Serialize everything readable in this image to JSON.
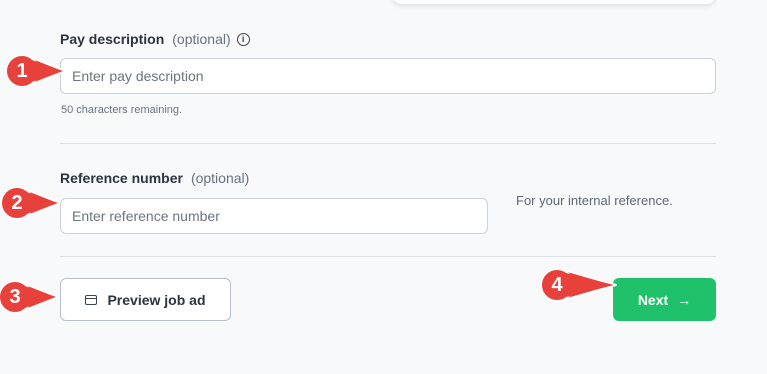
{
  "pay_description": {
    "label": "Pay description",
    "optional": "(optional)",
    "info_icon": "info-circle-icon",
    "placeholder": "Enter pay description",
    "value": "",
    "helper": "50 characters remaining."
  },
  "reference_number": {
    "label": "Reference number",
    "optional": "(optional)",
    "placeholder": "Enter reference number",
    "value": "",
    "note": "For your internal reference."
  },
  "actions": {
    "preview_label": "Preview job ad",
    "preview_icon": "window-icon",
    "next_label": "Next",
    "next_icon": "arrow-right-icon"
  },
  "markers": [
    "1",
    "2",
    "3",
    "4"
  ],
  "colors": {
    "accent": "#1fc26b",
    "marker": "#e8413b",
    "background": "#f8f9fb"
  }
}
